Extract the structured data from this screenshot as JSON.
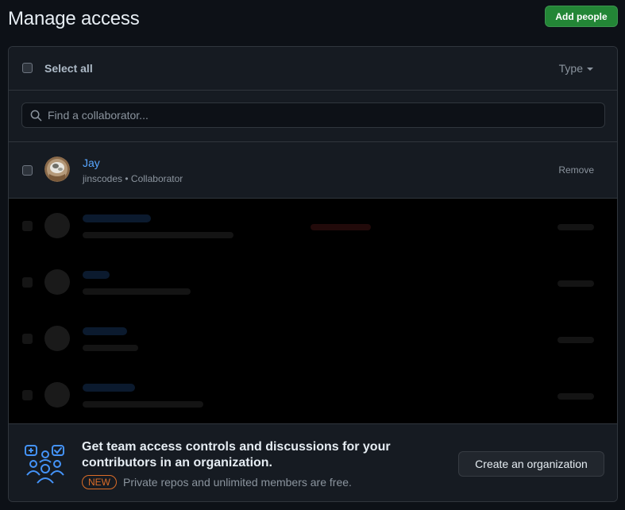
{
  "page": {
    "title": "Manage access",
    "add_button": "Add people"
  },
  "toolbar": {
    "select_all": "Select all",
    "type_menu": "Type"
  },
  "search": {
    "placeholder": "Find a collaborator..."
  },
  "members": [
    {
      "name": "Jay",
      "username": "jinscodes",
      "role": "Collaborator",
      "remove": "Remove"
    }
  ],
  "promo": {
    "title": "Get team access controls and discussions for your contributors in an organization.",
    "badge": "NEW",
    "subtitle": "Private repos and unlimited members are free.",
    "button": "Create an organization"
  },
  "icons": {
    "search": "search-icon",
    "type_caret": "caret-down-icon",
    "promo": "team-illustration-icon"
  },
  "colors": {
    "accent_green": "#238636",
    "link_blue": "#58a6ff",
    "badge_orange": "#db6d28",
    "background": "#0d1117",
    "surface": "#161b22"
  }
}
